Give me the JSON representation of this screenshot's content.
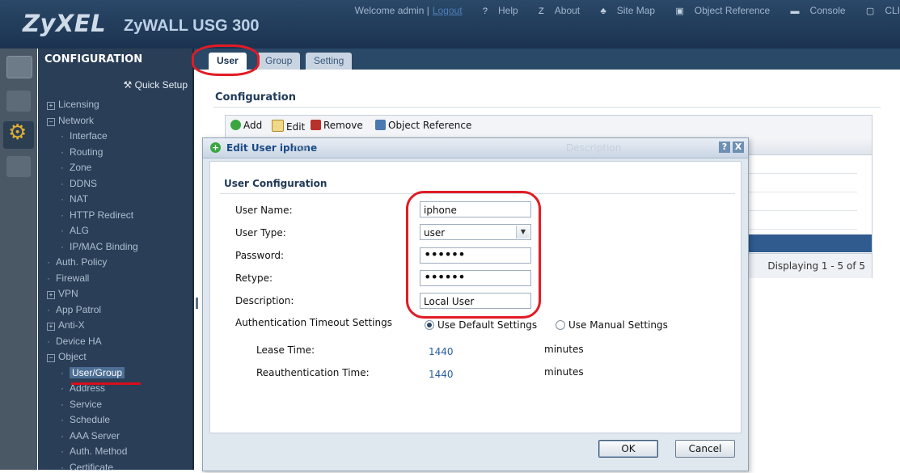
{
  "banner": {
    "brand": "ZyXEL",
    "model": "ZyWALL USG 300",
    "welcome": "Welcome admin |",
    "logout": "Logout",
    "links": [
      "Help",
      "About",
      "Site Map",
      "Object Reference",
      "Console",
      "CLI"
    ],
    "link_icons": [
      "help-icon",
      "about-icon",
      "sitemap-icon",
      "object-reference-icon",
      "console-icon",
      "cli-icon"
    ]
  },
  "nav": {
    "header": "CONFIGURATION",
    "quick_setup": "Quick Setup",
    "items": [
      {
        "label": "Licensing",
        "marker": "⊞"
      },
      {
        "label": "Network",
        "marker": "⊟"
      },
      {
        "label": "Interface",
        "marker": "-",
        "sub": true
      },
      {
        "label": "Routing",
        "marker": "-",
        "sub": true
      },
      {
        "label": "Zone",
        "marker": "-",
        "sub": true
      },
      {
        "label": "DDNS",
        "marker": "-",
        "sub": true
      },
      {
        "label": "NAT",
        "marker": "-",
        "sub": true
      },
      {
        "label": "HTTP Redirect",
        "marker": "-",
        "sub": true
      },
      {
        "label": "ALG",
        "marker": "-",
        "sub": true
      },
      {
        "label": "IP/MAC Binding",
        "marker": "-",
        "sub": true
      },
      {
        "label": "Auth. Policy",
        "marker": "-"
      },
      {
        "label": "Firewall",
        "marker": "-"
      },
      {
        "label": "VPN",
        "marker": "⊞"
      },
      {
        "label": "App Patrol",
        "marker": "-"
      },
      {
        "label": "Anti-X",
        "marker": "⊞"
      },
      {
        "label": "Device HA",
        "marker": "-"
      },
      {
        "label": "Object",
        "marker": "⊟"
      },
      {
        "label": "User/Group",
        "marker": "-",
        "sub": true,
        "active": true
      },
      {
        "label": "Address",
        "marker": "-",
        "sub": true
      },
      {
        "label": "Service",
        "marker": "-",
        "sub": true
      },
      {
        "label": "Schedule",
        "marker": "-",
        "sub": true
      },
      {
        "label": "AAA Server",
        "marker": "-",
        "sub": true
      },
      {
        "label": "Auth. Method",
        "marker": "-",
        "sub": true
      },
      {
        "label": "Certificate",
        "marker": "-",
        "sub": true
      }
    ]
  },
  "tabs": {
    "user": "User",
    "group": "Group",
    "setting": "Setting"
  },
  "main": {
    "section_title": "Configuration",
    "toolbar": {
      "add": "Add",
      "edit": "Edit",
      "remove": "Remove",
      "object_reference": "Object Reference"
    },
    "pager": "Displaying 1 - 5 of 5"
  },
  "dialog": {
    "title": "Edit User iphone",
    "ghost_col_name": "me",
    "ghost_col_desc": "Description",
    "help": "?",
    "close": "X",
    "section": "User Configuration",
    "fields": {
      "user_name": {
        "label": "User Name:",
        "value": "iphone"
      },
      "user_type": {
        "label": "User Type:",
        "value": "user"
      },
      "password": {
        "label": "Password:",
        "value": "••••••"
      },
      "retype": {
        "label": "Retype:",
        "value": "••••••"
      },
      "description": {
        "label": "Description:",
        "value": "Local User"
      }
    },
    "timeout": {
      "label": "Authentication Timeout Settings",
      "default_option": "Use Default Settings",
      "manual_option": "Use Manual Settings",
      "selected": "default"
    },
    "lease": {
      "label": "Lease Time:",
      "value": "1440",
      "unit": "minutes"
    },
    "reauth": {
      "label": "Reauthentication Time:",
      "value": "1440",
      "unit": "minutes"
    },
    "ok": "OK",
    "cancel": "Cancel"
  },
  "colors": {
    "highlight_circle": "#e21b24",
    "banner": "#1b3350",
    "nav": "#2a3e57",
    "selected_row": "#2f5b8f"
  }
}
